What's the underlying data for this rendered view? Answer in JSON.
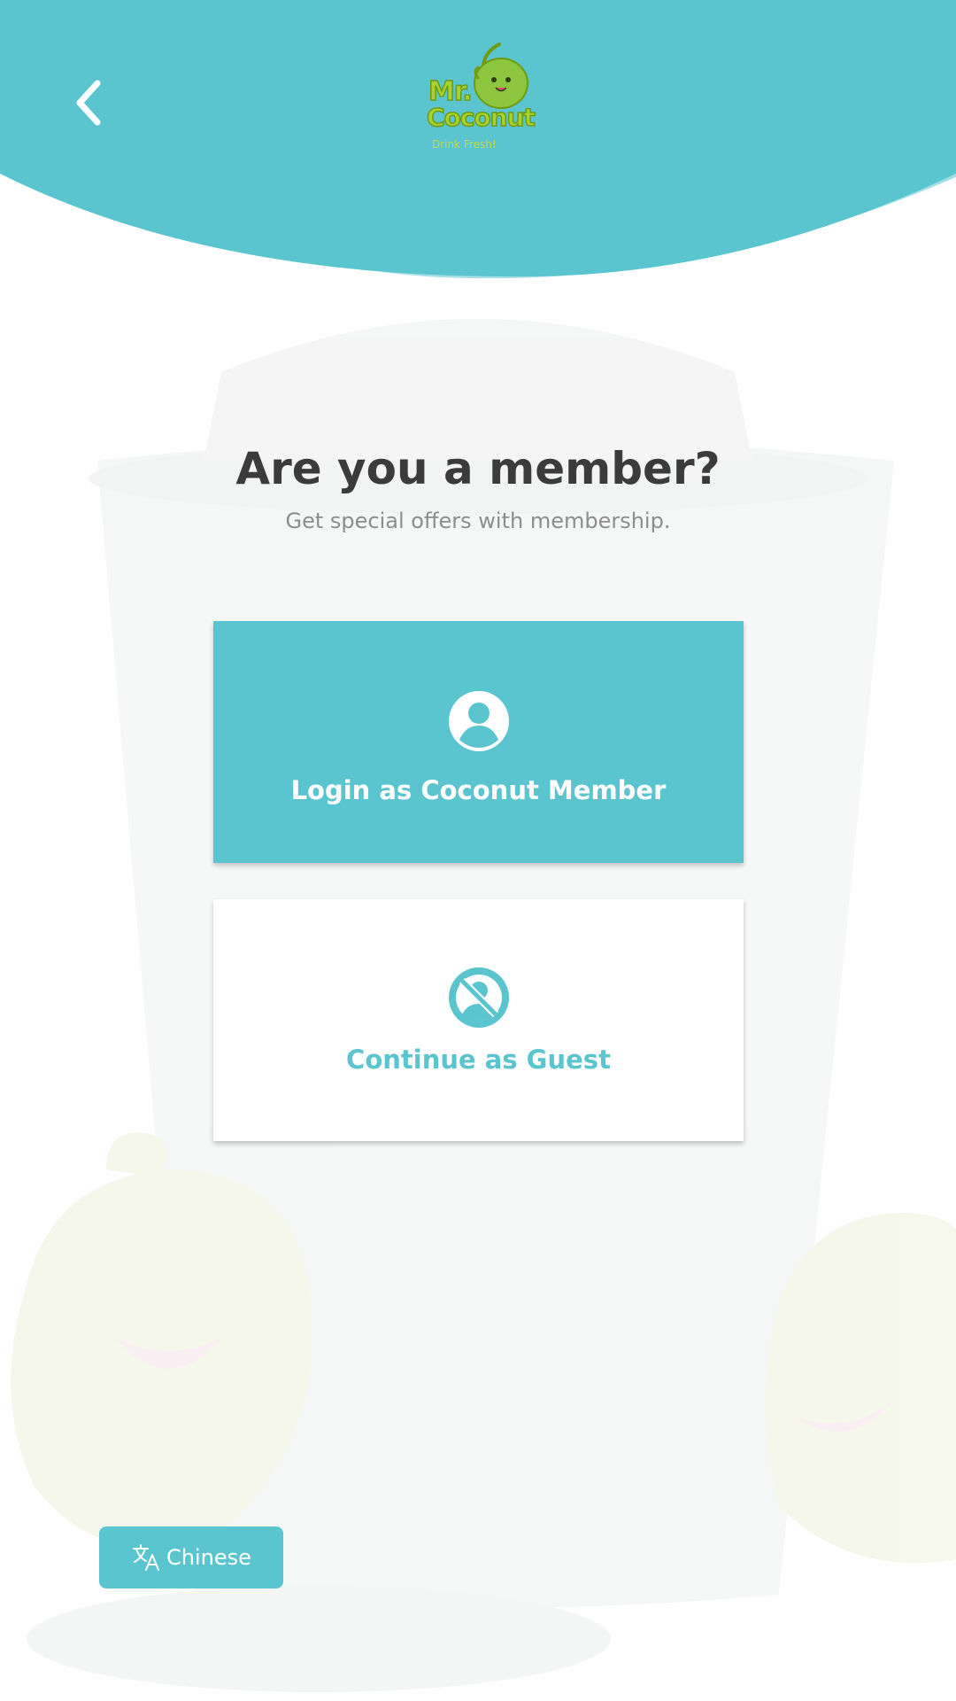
{
  "colors": {
    "accent": "#5bc5cf",
    "header": "#5bc5cf",
    "header_wave_light": "#a6dfe5",
    "title_text": "#3b3b3b",
    "subtitle_text": "#8d8d8d",
    "logo_green": "#a8d22e"
  },
  "header": {
    "back_icon": "chevron-left-icon",
    "logo": {
      "line1": "Mr.",
      "line2": "Coconut",
      "tagline": "Drink Fresh!"
    }
  },
  "main": {
    "title": "Are you a member?",
    "subtitle": "Get special offers with membership.",
    "options": [
      {
        "icon": "user-circle-icon",
        "label": "Login as Coconut Member"
      },
      {
        "icon": "no-user-icon",
        "label": "Continue as Guest"
      }
    ]
  },
  "footer": {
    "language_button": {
      "icon": "translate-icon",
      "label": "Chinese"
    }
  }
}
